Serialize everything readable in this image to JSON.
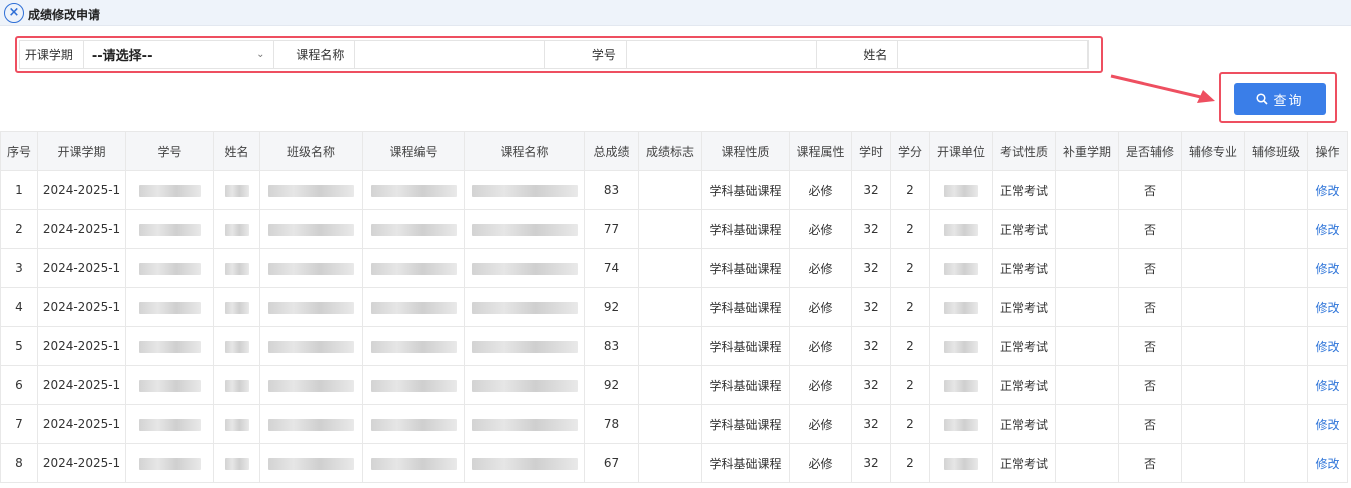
{
  "window": {
    "title": "成绩修改申请",
    "close_icon": "close-circle-icon"
  },
  "filters": {
    "term_label": "开课学期",
    "term_value": "--请选择--",
    "course_name_label": "课程名称",
    "student_id_label": "学号",
    "name_label": "姓名"
  },
  "query": {
    "label": "查询",
    "icon": "search-icon",
    "accent": "#3a7ee8",
    "highlight": "#ee4f60"
  },
  "table": {
    "headers": [
      "序号",
      "开课学期",
      "学号",
      "姓名",
      "班级名称",
      "课程编号",
      "课程名称",
      "总成绩",
      "成绩标志",
      "课程性质",
      "课程属性",
      "学时",
      "学分",
      "开课单位",
      "考试性质",
      "补重学期",
      "是否辅修",
      "辅修专业",
      "辅修班级",
      "操作"
    ],
    "rows": [
      {
        "no": "1",
        "term": "2024-2025-1",
        "score": "83",
        "mark": "",
        "nature": "学科基础课程",
        "attr": "必修",
        "hours": "32",
        "credit": "2",
        "exam": "正常考试",
        "retake": "",
        "minor": "否",
        "minor_major": "",
        "minor_class": "",
        "action": "修改"
      },
      {
        "no": "2",
        "term": "2024-2025-1",
        "score": "77",
        "mark": "",
        "nature": "学科基础课程",
        "attr": "必修",
        "hours": "32",
        "credit": "2",
        "exam": "正常考试",
        "retake": "",
        "minor": "否",
        "minor_major": "",
        "minor_class": "",
        "action": "修改"
      },
      {
        "no": "3",
        "term": "2024-2025-1",
        "score": "74",
        "mark": "",
        "nature": "学科基础课程",
        "attr": "必修",
        "hours": "32",
        "credit": "2",
        "exam": "正常考试",
        "retake": "",
        "minor": "否",
        "minor_major": "",
        "minor_class": "",
        "action": "修改"
      },
      {
        "no": "4",
        "term": "2024-2025-1",
        "score": "92",
        "mark": "",
        "nature": "学科基础课程",
        "attr": "必修",
        "hours": "32",
        "credit": "2",
        "exam": "正常考试",
        "retake": "",
        "minor": "否",
        "minor_major": "",
        "minor_class": "",
        "action": "修改"
      },
      {
        "no": "5",
        "term": "2024-2025-1",
        "score": "83",
        "mark": "",
        "nature": "学科基础课程",
        "attr": "必修",
        "hours": "32",
        "credit": "2",
        "exam": "正常考试",
        "retake": "",
        "minor": "否",
        "minor_major": "",
        "minor_class": "",
        "action": "修改"
      },
      {
        "no": "6",
        "term": "2024-2025-1",
        "score": "92",
        "mark": "",
        "nature": "学科基础课程",
        "attr": "必修",
        "hours": "32",
        "credit": "2",
        "exam": "正常考试",
        "retake": "",
        "minor": "否",
        "minor_major": "",
        "minor_class": "",
        "action": "修改"
      },
      {
        "no": "7",
        "term": "2024-2025-1",
        "score": "78",
        "mark": "",
        "nature": "学科基础课程",
        "attr": "必修",
        "hours": "32",
        "credit": "2",
        "exam": "正常考试",
        "retake": "",
        "minor": "否",
        "minor_major": "",
        "minor_class": "",
        "action": "修改"
      },
      {
        "no": "8",
        "term": "2024-2025-1",
        "score": "67",
        "mark": "",
        "nature": "学科基础课程",
        "attr": "必修",
        "hours": "32",
        "credit": "2",
        "exam": "正常考试",
        "retake": "",
        "minor": "否",
        "minor_major": "",
        "minor_class": "",
        "action": "修改"
      }
    ]
  }
}
